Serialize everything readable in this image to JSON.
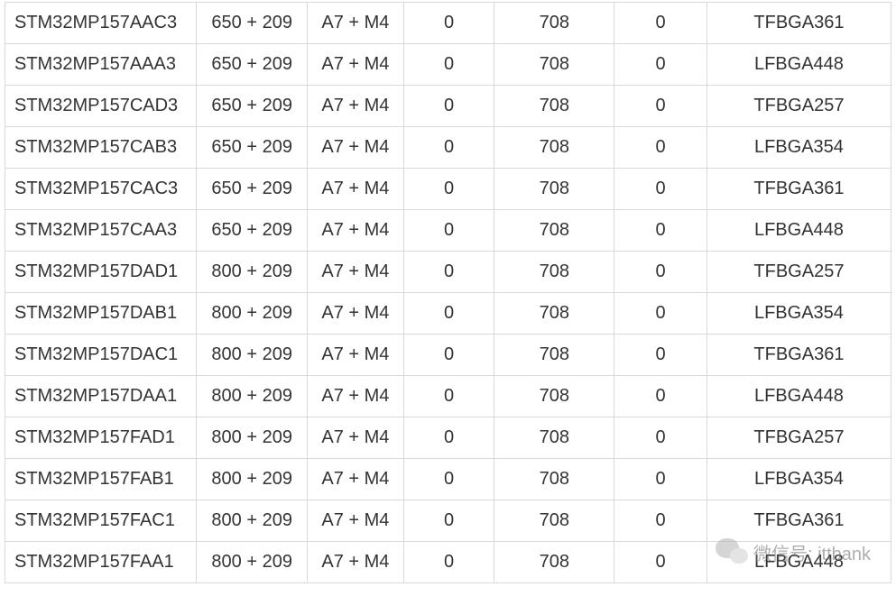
{
  "table": {
    "rows": [
      {
        "part": "STM32MP157AAC3",
        "freq": "650 + 209",
        "core": "A7 + M4",
        "c1": "0",
        "val": "708",
        "c2": "0",
        "pkg": "TFBGA361"
      },
      {
        "part": "STM32MP157AAA3",
        "freq": "650 + 209",
        "core": "A7 + M4",
        "c1": "0",
        "val": "708",
        "c2": "0",
        "pkg": "LFBGA448"
      },
      {
        "part": "STM32MP157CAD3",
        "freq": "650 + 209",
        "core": "A7 + M4",
        "c1": "0",
        "val": "708",
        "c2": "0",
        "pkg": "TFBGA257"
      },
      {
        "part": "STM32MP157CAB3",
        "freq": "650 + 209",
        "core": "A7 + M4",
        "c1": "0",
        "val": "708",
        "c2": "0",
        "pkg": "LFBGA354"
      },
      {
        "part": "STM32MP157CAC3",
        "freq": "650 + 209",
        "core": "A7 + M4",
        "c1": "0",
        "val": "708",
        "c2": "0",
        "pkg": "TFBGA361"
      },
      {
        "part": "STM32MP157CAA3",
        "freq": "650 + 209",
        "core": "A7 + M4",
        "c1": "0",
        "val": "708",
        "c2": "0",
        "pkg": "LFBGA448"
      },
      {
        "part": "STM32MP157DAD1",
        "freq": "800 + 209",
        "core": "A7 + M4",
        "c1": "0",
        "val": "708",
        "c2": "0",
        "pkg": "TFBGA257"
      },
      {
        "part": "STM32MP157DAB1",
        "freq": "800 + 209",
        "core": "A7 + M4",
        "c1": "0",
        "val": "708",
        "c2": "0",
        "pkg": "LFBGA354"
      },
      {
        "part": "STM32MP157DAC1",
        "freq": "800 + 209",
        "core": "A7 + M4",
        "c1": "0",
        "val": "708",
        "c2": "0",
        "pkg": "TFBGA361"
      },
      {
        "part": "STM32MP157DAA1",
        "freq": "800 + 209",
        "core": "A7 + M4",
        "c1": "0",
        "val": "708",
        "c2": "0",
        "pkg": "LFBGA448"
      },
      {
        "part": "STM32MP157FAD1",
        "freq": "800 + 209",
        "core": "A7 + M4",
        "c1": "0",
        "val": "708",
        "c2": "0",
        "pkg": "TFBGA257"
      },
      {
        "part": "STM32MP157FAB1",
        "freq": "800 + 209",
        "core": "A7 + M4",
        "c1": "0",
        "val": "708",
        "c2": "0",
        "pkg": "LFBGA354"
      },
      {
        "part": "STM32MP157FAC1",
        "freq": "800 + 209",
        "core": "A7 + M4",
        "c1": "0",
        "val": "708",
        "c2": "0",
        "pkg": "TFBGA361"
      },
      {
        "part": "STM32MP157FAA1",
        "freq": "800 + 209",
        "core": "A7 + M4",
        "c1": "0",
        "val": "708",
        "c2": "0",
        "pkg": "LFBGA448"
      }
    ]
  },
  "watermark": {
    "text": "微信号: ittbank"
  }
}
